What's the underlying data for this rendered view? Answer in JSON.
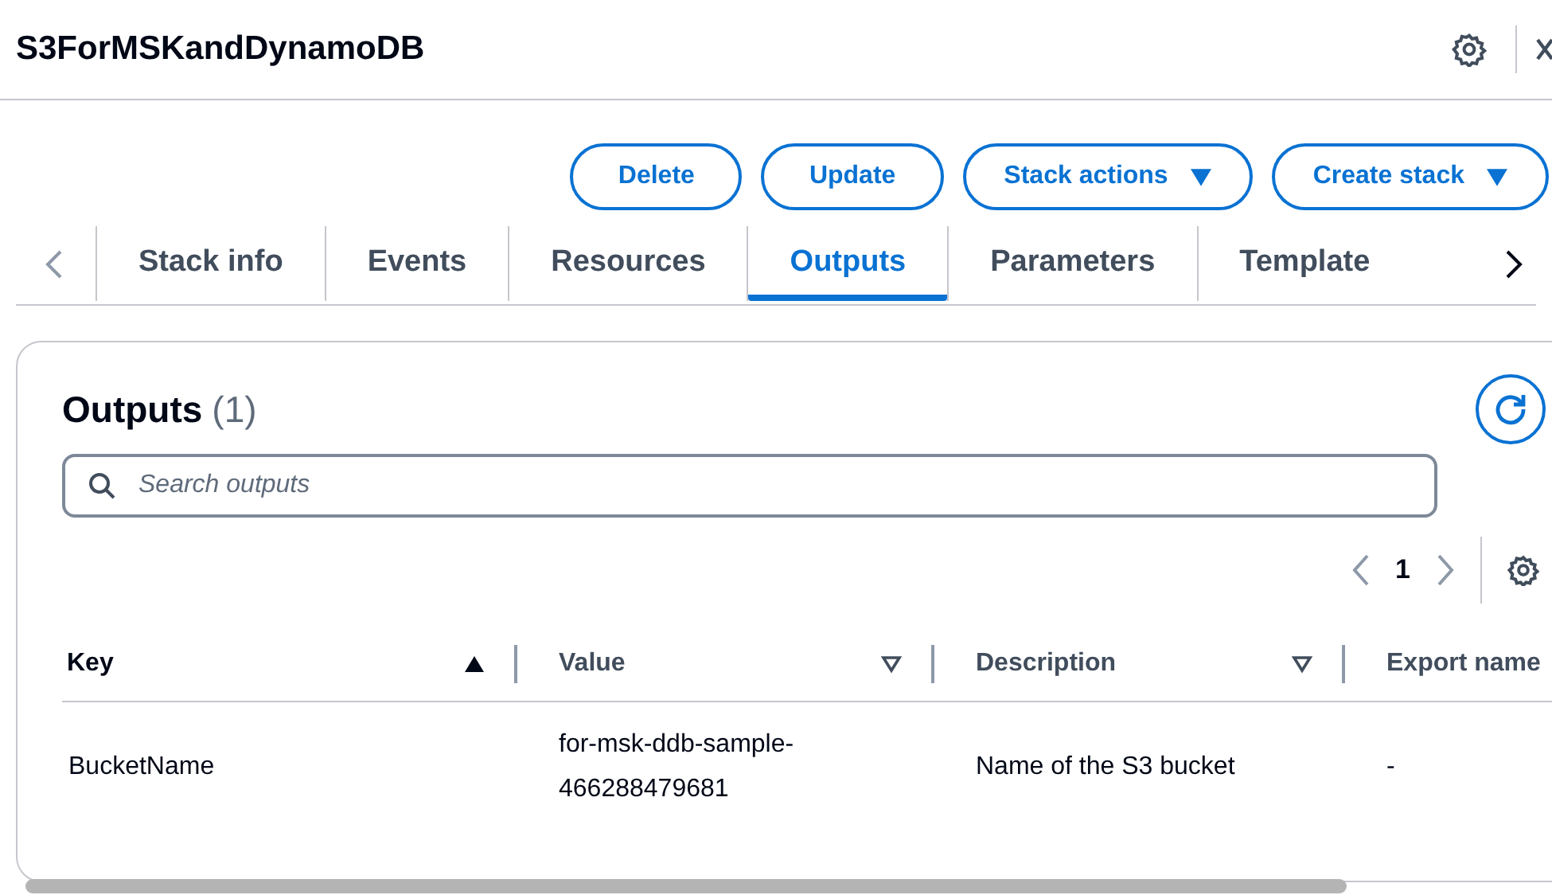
{
  "header": {
    "title": "S3ForMSKandDynamoDB"
  },
  "actions": [
    {
      "label": "Delete",
      "dropdown": false
    },
    {
      "label": "Update",
      "dropdown": false
    },
    {
      "label": "Stack actions",
      "dropdown": true
    },
    {
      "label": "Create stack",
      "dropdown": true
    }
  ],
  "tabs": [
    {
      "label": "Stack info",
      "selected": false
    },
    {
      "label": "Events",
      "selected": false
    },
    {
      "label": "Resources",
      "selected": false
    },
    {
      "label": "Outputs",
      "selected": true
    },
    {
      "label": "Parameters",
      "selected": false
    },
    {
      "label": "Template",
      "selected": false
    }
  ],
  "panel": {
    "title": "Outputs",
    "count": "(1)",
    "search": {
      "placeholder": "Search outputs"
    },
    "page": "1"
  },
  "table": {
    "columns": [
      {
        "label": "Key",
        "sorted": true
      },
      {
        "label": "Value",
        "sorted": false
      },
      {
        "label": "Description",
        "sorted": false
      },
      {
        "label": "Export name"
      }
    ],
    "rows": [
      [
        "BucketName",
        "for-msk-ddb-sample-466288479681",
        "Name of the S3 bucket",
        "-"
      ]
    ]
  }
}
